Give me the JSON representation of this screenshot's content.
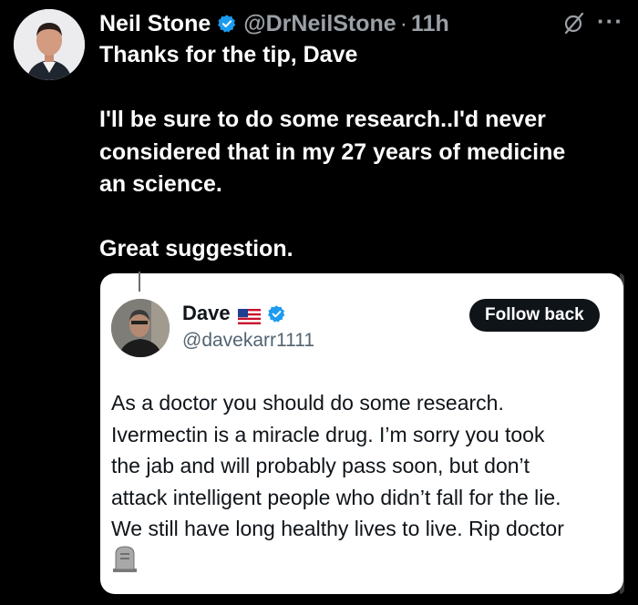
{
  "tweet": {
    "author_name": "Neil Stone",
    "handle": "@DrNeilStone",
    "separator": "·",
    "time": "11h",
    "more_label": "···",
    "lines": [
      "Thanks for the tip, Dave",
      "",
      "I'll be sure to do some research..I'd never",
      "considered that in my 27 years of medicine",
      "an science.",
      "",
      "Great suggestion."
    ]
  },
  "quoted": {
    "author_name": "Dave",
    "handle": "@davekarr1111",
    "follow_label": "Follow back",
    "lines": [
      "As a doctor you should do some research.",
      "Ivermectin is a miracle drug. I’m sorry you took",
      "the jab and will probably pass soon, but don’t",
      "attack intelligent people who didn’t fall for the lie.",
      "We still have long healthy lives to live. Rip doctor"
    ]
  },
  "icons": {
    "verified": "verified-badge-icon",
    "grok": "grok-icon",
    "more": "more-icon",
    "flag": "us-flag-icon",
    "headstone": "headstone-icon"
  },
  "colors": {
    "background": "#000000",
    "verified_blue": "#1d9bf0",
    "muted_gray": "#9aa0a6",
    "card_bg": "#ffffff",
    "button_bg": "#0f1419"
  }
}
